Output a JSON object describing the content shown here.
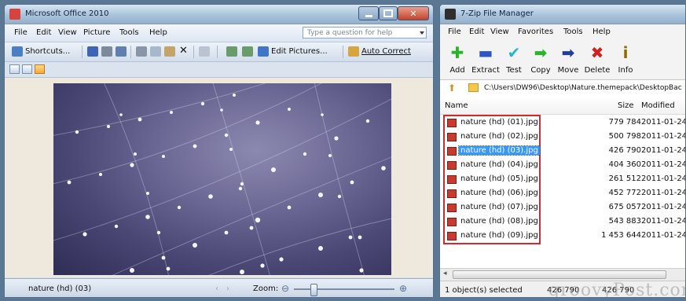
{
  "office": {
    "title": "Microsoft Office 2010",
    "menu": [
      {
        "label": "File"
      },
      {
        "label": "Edit"
      },
      {
        "label": "View"
      },
      {
        "label": "Picture"
      },
      {
        "label": "Tools"
      },
      {
        "label": "Help"
      }
    ],
    "help_placeholder": "Type a question for help",
    "toolbar": {
      "shortcuts_label": "Shortcuts...",
      "edit_pictures_label": "Edit Pictures...",
      "auto_correct_label": "Auto Correct"
    },
    "status": {
      "file_name": "nature (hd) (03)",
      "zoom_label": "Zoom:"
    },
    "colors": {
      "title_icon": "#d9433d",
      "photo_dark": "#2f2c55",
      "photo_light": "#8c89b0"
    }
  },
  "zip": {
    "title": "7-Zip File Manager",
    "menu": [
      {
        "label": "File"
      },
      {
        "label": "Edit"
      },
      {
        "label": "View"
      },
      {
        "label": "Favorites"
      },
      {
        "label": "Tools"
      },
      {
        "label": "Help"
      }
    ],
    "toolbar": [
      {
        "label": "Add",
        "icon": "add-icon",
        "glyph": "✚",
        "color": "#2bb32b"
      },
      {
        "label": "Extract",
        "icon": "extract-icon",
        "glyph": "▬",
        "color": "#2b55c8"
      },
      {
        "label": "Test",
        "icon": "test-icon",
        "glyph": "✔",
        "color": "#26b6c4"
      },
      {
        "label": "Copy",
        "icon": "copy-icon",
        "glyph": "➡",
        "color": "#2bb32b"
      },
      {
        "label": "Move",
        "icon": "move-icon",
        "glyph": "➡",
        "color": "#1f3f9e"
      },
      {
        "label": "Delete",
        "icon": "delete-icon",
        "glyph": "✖",
        "color": "#d21f1f"
      },
      {
        "label": "Info",
        "icon": "info-icon",
        "glyph": "i",
        "color": "#8a6d00"
      }
    ],
    "path": "C:\\Users\\DW96\\Desktop\\Nature.themepack\\DesktopBac",
    "columns": {
      "name": "Name",
      "size": "Size",
      "modified": "Modified"
    },
    "files": [
      {
        "name": "nature (hd) (01).jpg",
        "size": "779 784",
        "modified": "2011-01-24"
      },
      {
        "name": "nature (hd) (02).jpg",
        "size": "500 798",
        "modified": "2011-01-24"
      },
      {
        "name": "nature (hd) (03).jpg",
        "size": "426 790",
        "modified": "2011-01-24",
        "selected": true
      },
      {
        "name": "nature (hd) (04).jpg",
        "size": "404 360",
        "modified": "2011-01-24"
      },
      {
        "name": "nature (hd) (05).jpg",
        "size": "261 512",
        "modified": "2011-01-24"
      },
      {
        "name": "nature (hd) (06).jpg",
        "size": "452 772",
        "modified": "2011-01-24"
      },
      {
        "name": "nature (hd) (07).jpg",
        "size": "675 057",
        "modified": "2011-01-24"
      },
      {
        "name": "nature (hd) (08).jpg",
        "size": "543 883",
        "modified": "2011-01-24"
      },
      {
        "name": "nature (hd) (09).jpg",
        "size": "1 453 644",
        "modified": "2011-01-24"
      }
    ],
    "status": {
      "selected": "1 object(s) selected",
      "size_a": "426 790",
      "size_b": "426 790",
      "watermark": "groovyPost.com"
    },
    "colors": {
      "selection": "#3399ff",
      "highlight_box": "#d7282e"
    }
  }
}
